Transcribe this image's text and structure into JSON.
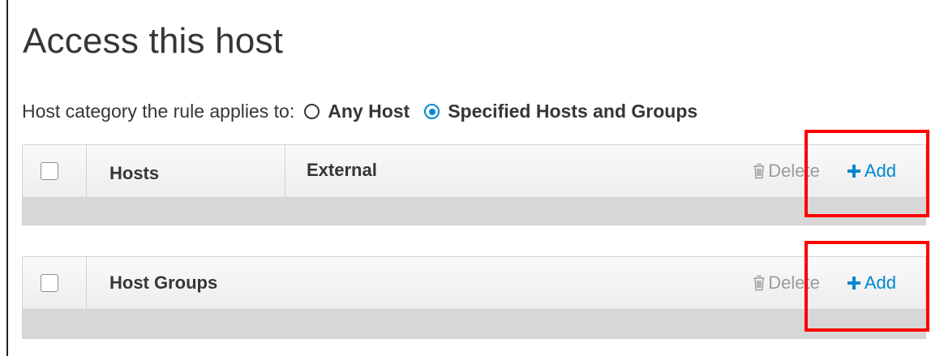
{
  "page": {
    "title": "Access this host"
  },
  "host_category": {
    "label": "Host category the rule applies to:",
    "options": [
      {
        "label": "Any Host",
        "selected": false
      },
      {
        "label": "Specified Hosts and Groups",
        "selected": true
      }
    ]
  },
  "hosts_table": {
    "columns": [
      "Hosts",
      "External"
    ],
    "delete_label": "Delete",
    "add_label": "Add",
    "rows": []
  },
  "host_groups_table": {
    "columns": [
      "Host Groups"
    ],
    "delete_label": "Delete",
    "add_label": "Add",
    "rows": []
  },
  "colors": {
    "accent": "#0088ce",
    "disabled": "#9c9c9c",
    "highlight": "#ff0000"
  },
  "icons": {
    "delete": "trash-icon",
    "add": "plus-icon"
  }
}
